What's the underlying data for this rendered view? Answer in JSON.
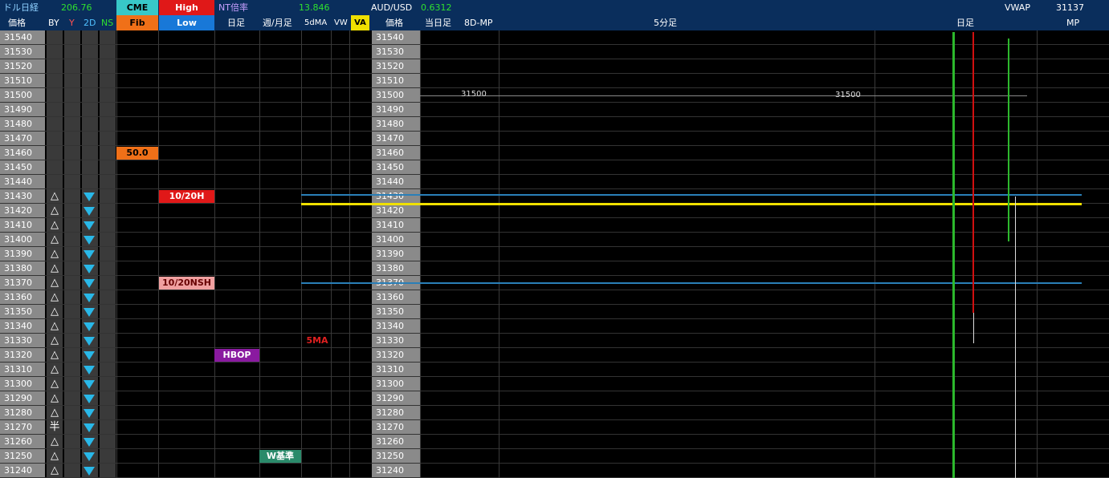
{
  "header": {
    "dol_nikkei_label": "ドル日経",
    "dol_nikkei_value": "206.76",
    "cme_label": "CME",
    "high_label": "High",
    "nt_label": "NT倍率",
    "nt_value": "13.846",
    "audusd_label": "AUD/USD",
    "audusd_value": "0.6312",
    "vwap_label": "VWAP",
    "vwap_value": "31137",
    "price_label": "価格",
    "by_label": "BY",
    "y_label": "Y",
    "twod_label": "2D",
    "ns_label": "NS",
    "fib_label": "Fib",
    "low_label": "Low",
    "daily_label": "日足",
    "weekly_label": "週/月足",
    "fivedma_label": "5dMA",
    "vw_label": "VW",
    "va_label": "VA",
    "price2_label": "価格",
    "today_label": "当日足",
    "mp8d_label": "8D-MP",
    "fivemin_label": "5分足",
    "daily2_label": "日足",
    "mp_label": "MP"
  },
  "prices": [
    "31540",
    "31530",
    "31520",
    "31510",
    "31500",
    "31490",
    "31480",
    "31470",
    "31460",
    "31450",
    "31440",
    "31430",
    "31420",
    "31410",
    "31400",
    "31390",
    "31380",
    "31370",
    "31360",
    "31350",
    "31340",
    "31330",
    "31320",
    "31310",
    "31300",
    "31290",
    "31280",
    "31270",
    "31260",
    "31250",
    "31240"
  ],
  "by_symbols": [
    "",
    "",
    "",
    "",
    "",
    "",
    "",
    "",
    "",
    "",
    "",
    "△",
    "△",
    "△",
    "△",
    "△",
    "△",
    "△",
    "△",
    "△",
    "△",
    "△",
    "△",
    "△",
    "△",
    "△",
    "△",
    "半",
    "△",
    "△",
    "△"
  ],
  "badges": {
    "fib": "50.0",
    "high_date": "10/20H",
    "nsh_date": "10/20NSH",
    "hbop": "HBOP",
    "fivema": "5MA",
    "kijun": "W基準"
  },
  "chart_labels": {
    "level_left": "31500",
    "level_right": "31500"
  },
  "colors": {
    "header_bg": "#0a2e5c",
    "price_col": "#8a8a8a",
    "yellow_line": "#f0e000",
    "blue_line": "#2a7fb8",
    "green_line": "#2db82d",
    "red_line": "#d01010"
  }
}
